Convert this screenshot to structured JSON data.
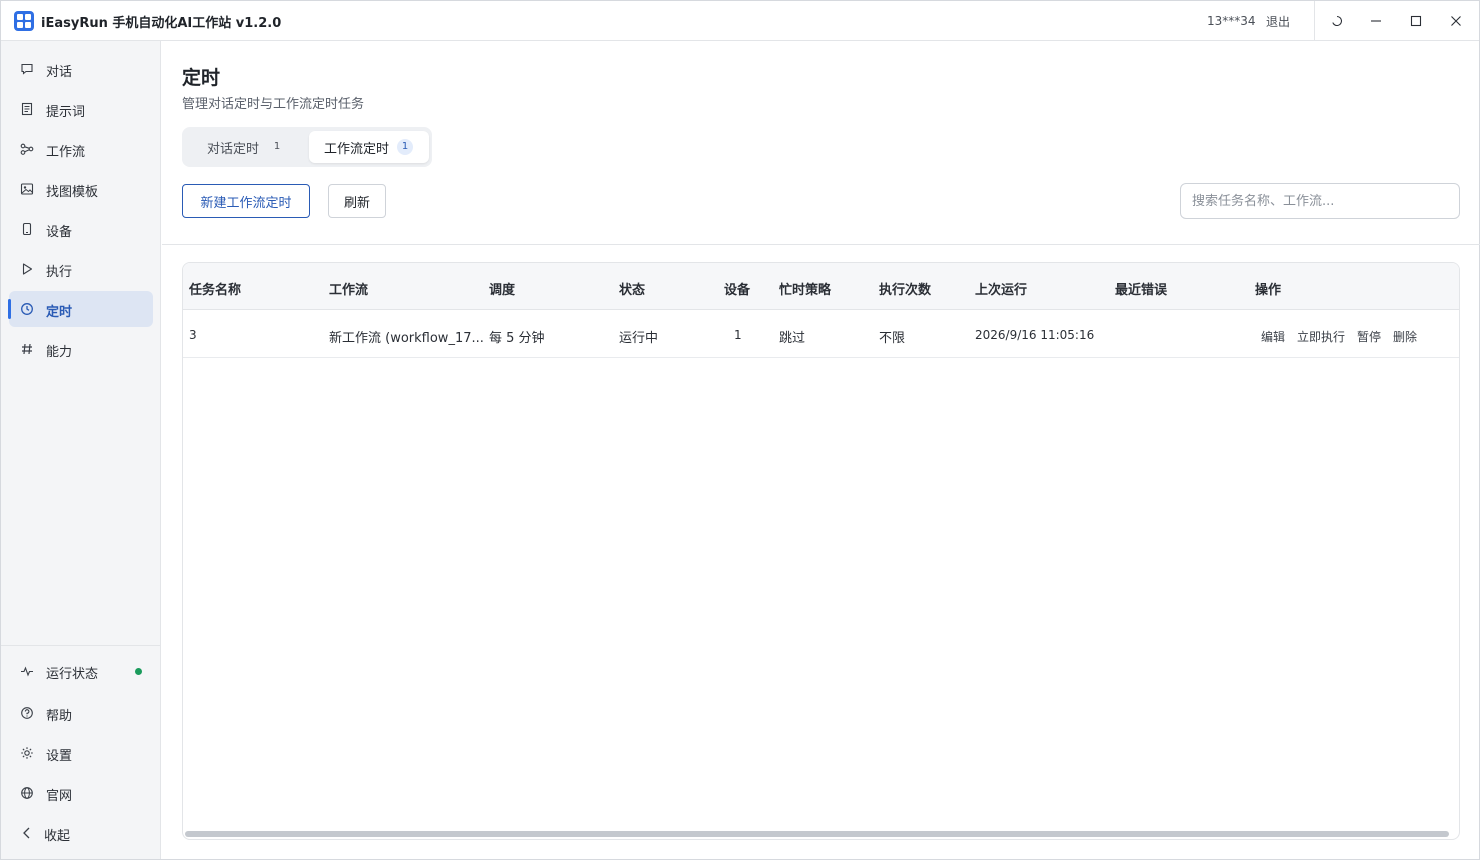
{
  "window": {
    "title": "iEasyRun 手机自动化AI工作站 v1.2.0",
    "user": "13***34",
    "logout_label": "退出",
    "controls": [
      "refresh-icon",
      "minimize-icon",
      "maximize-icon",
      "close-icon"
    ]
  },
  "sidebar": {
    "items": [
      {
        "label": "对话",
        "icon": "chat-icon"
      },
      {
        "label": "提示词",
        "icon": "document-icon"
      },
      {
        "label": "工作流",
        "icon": "workflow-icon"
      },
      {
        "label": "找图模板",
        "icon": "image-icon"
      },
      {
        "label": "设备",
        "icon": "phone-icon"
      },
      {
        "label": "执行",
        "icon": "play-icon"
      },
      {
        "label": "定时",
        "icon": "clock-icon",
        "active": true
      },
      {
        "label": "能力",
        "icon": "hash-icon"
      }
    ],
    "bottom": [
      {
        "label": "运行状态",
        "icon": "activity-icon",
        "status_color": "#1a9b5c"
      },
      {
        "label": "帮助",
        "icon": "help-icon"
      },
      {
        "label": "设置",
        "icon": "gear-icon"
      },
      {
        "label": "官网",
        "icon": "globe-icon"
      },
      {
        "label": "收起",
        "icon": "chevron-left-icon"
      }
    ]
  },
  "main": {
    "title": "定时",
    "subtitle": "管理对话定时与工作流定时任务",
    "tabs": [
      {
        "label": "对话定时",
        "count": "1"
      },
      {
        "label": "工作流定时",
        "count": "1",
        "active": true
      }
    ],
    "new_button": "新建工作流定时",
    "refresh_button": "刷新",
    "search_placeholder": "搜索任务名称、工作流...",
    "table": {
      "columns": [
        "任务名称",
        "工作流",
        "调度",
        "状态",
        "设备",
        "忙时策略",
        "执行次数",
        "上次运行",
        "最近错误",
        "操作"
      ],
      "rows": [
        {
          "name": "3",
          "workflow": "新工作流 (workflow_17...",
          "schedule": "每 5 分钟",
          "status": "运行中",
          "device": "1",
          "busy_policy": "跳过",
          "run_count": "不限",
          "last_run": "2026/9/16 11:05:16",
          "last_error": "",
          "actions": [
            "编辑",
            "立即执行",
            "暂停",
            "删除"
          ]
        }
      ]
    }
  },
  "colors": {
    "accent": "#2f6fe4",
    "accent_text": "#2a5bb5",
    "active_bg": "#dde5f3",
    "status_ok": "#1a9b5c"
  }
}
